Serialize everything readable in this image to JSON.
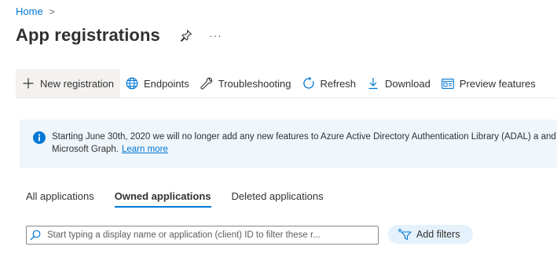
{
  "breadcrumb": {
    "home": "Home",
    "separator": ">"
  },
  "page": {
    "title": "App registrations",
    "more": "···"
  },
  "toolbar": {
    "new_registration": "New registration",
    "endpoints": "Endpoints",
    "troubleshooting": "Troubleshooting",
    "refresh": "Refresh",
    "download": "Download",
    "preview_features": "Preview features"
  },
  "banner": {
    "text": "Starting June 30th, 2020 we will no longer add any new features to Azure Active Directory Authentication Library (ADAL) a and Microsoft Graph.",
    "link": "Learn more"
  },
  "tabs": [
    {
      "label": "All applications"
    },
    {
      "label": "Owned applications"
    },
    {
      "label": "Deleted applications"
    }
  ],
  "search": {
    "placeholder": "Start typing a display name or application (client) ID to filter these r...",
    "value": ""
  },
  "filters": {
    "add_label": "Add filters"
  },
  "colors": {
    "accent": "#0078d4",
    "banner_bg": "#eff6fc",
    "filter_bg": "#e5f1fb",
    "text": "#323130"
  }
}
